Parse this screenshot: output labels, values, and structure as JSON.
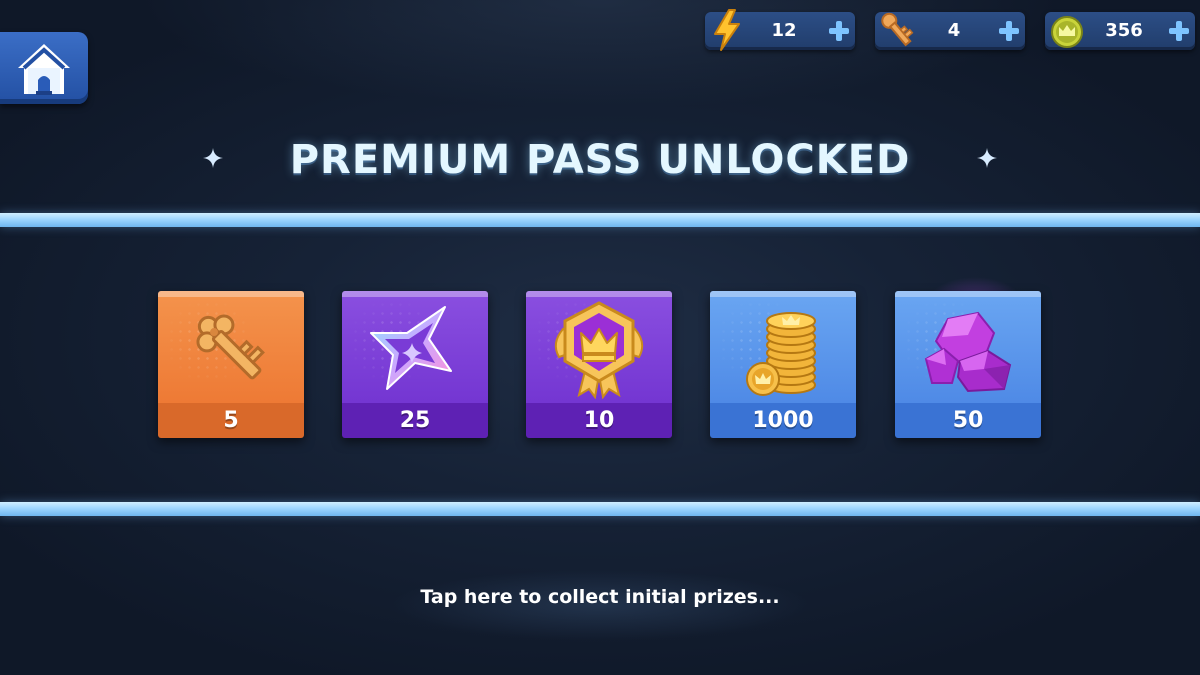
{
  "currencies": [
    {
      "name": "energy",
      "icon": "lightning-bolt-icon",
      "value": "12"
    },
    {
      "name": "keys",
      "icon": "key-icon",
      "value": "4"
    },
    {
      "name": "coins",
      "icon": "crown-coin-icon",
      "value": "356"
    }
  ],
  "title": "PREMIUM PASS UNLOCKED",
  "rewards": [
    {
      "icon": "key-icon",
      "amount": "5",
      "color": "#ee7a35"
    },
    {
      "icon": "shuriken-star-icon",
      "amount": "25",
      "color": "#7436d2"
    },
    {
      "icon": "crown-badge-icon",
      "amount": "10",
      "color": "#7436d2"
    },
    {
      "icon": "coin-stack-icon",
      "amount": "1000",
      "color": "#4f8ae6"
    },
    {
      "icon": "gems-icon",
      "amount": "50",
      "color": "#4f8ae6"
    }
  ],
  "collect_text": "Tap here to collect initial prizes...",
  "colors": {
    "background": "#162236",
    "bar": "#9ed6ff",
    "title": "#e4f7ff",
    "currency_pill": "#2c4e86"
  }
}
